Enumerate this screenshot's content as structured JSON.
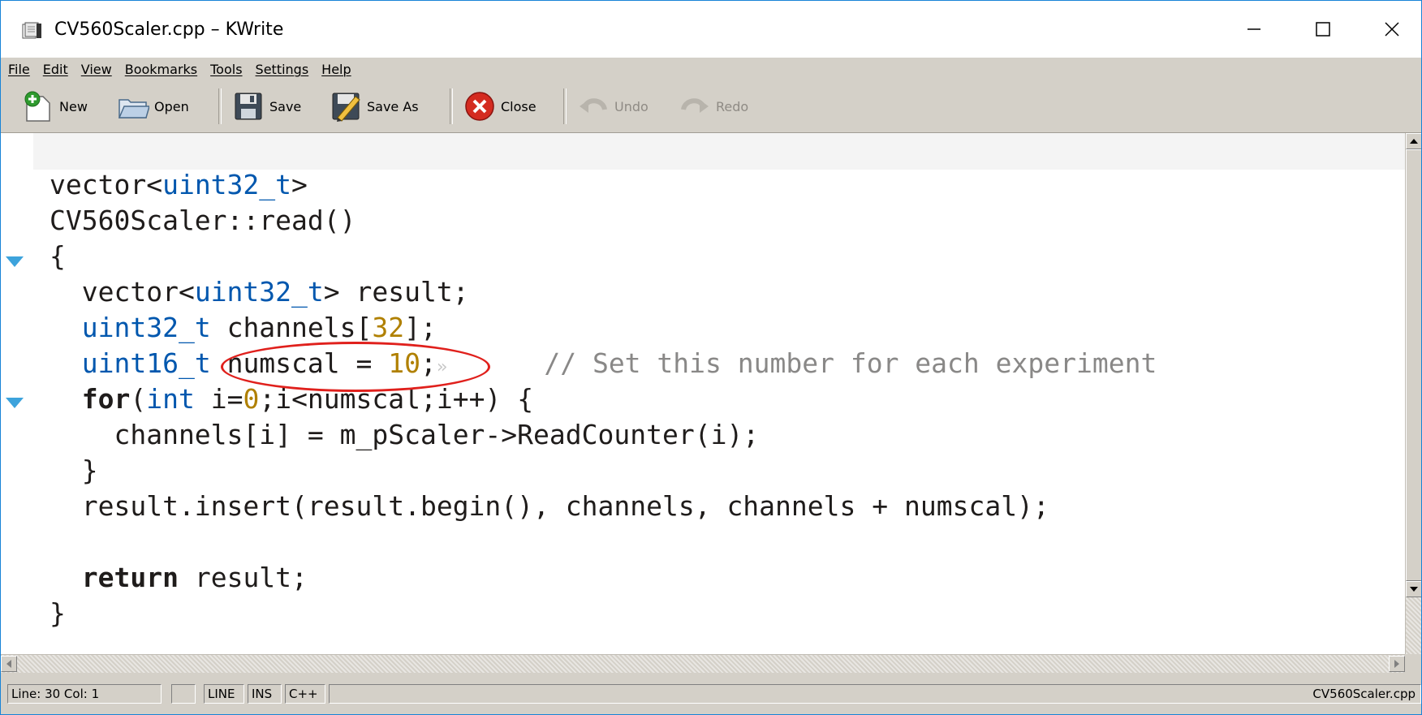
{
  "window": {
    "title": "CV560Scaler.cpp – KWrite"
  },
  "menu": [
    "File",
    "Edit",
    "View",
    "Bookmarks",
    "Tools",
    "Settings",
    "Help"
  ],
  "toolbar": {
    "new_label": "New",
    "open_label": "Open",
    "save_label": "Save",
    "save_as_label": "Save As",
    "close_label": "Close",
    "undo_label": "Undo",
    "redo_label": "Redo"
  },
  "editor": {
    "language": "C++",
    "lines": [
      "",
      "vector<uint32_t>",
      "CV560Scaler::read()",
      "{",
      "  vector<uint32_t> result;",
      "  uint32_t channels[32];",
      "  uint16_t numscal = 10;        // Set this number for each experiment",
      "  for(int i=0;i<numscal;i++) {",
      "    channels[i] = m_pScaler->ReadCounter(i);",
      "  }",
      "  result.insert(result.begin(), channels, channels + numscal);",
      "",
      "  return result;",
      "}"
    ],
    "annotation": "red ellipse around 'numscal = 10;'"
  },
  "statusbar": {
    "position": "Line: 30 Col: 1",
    "mode": "LINE",
    "insert": "INS",
    "syntax": "C++",
    "filename": "CV560Scaler.cpp"
  },
  "colors": {
    "type": "#0057ae",
    "number": "#b08000",
    "comment": "#898887",
    "fold_marker": "#3da3dc",
    "annotation": "#e0201c"
  },
  "icons": {
    "app": "kwrite-app-icon",
    "new": "new-document-icon",
    "open": "open-folder-icon",
    "save": "floppy-disk-icon",
    "save_as": "save-as-pencil-icon",
    "close": "close-circle-icon",
    "undo": "undo-arrow-icon",
    "redo": "redo-arrow-icon"
  }
}
